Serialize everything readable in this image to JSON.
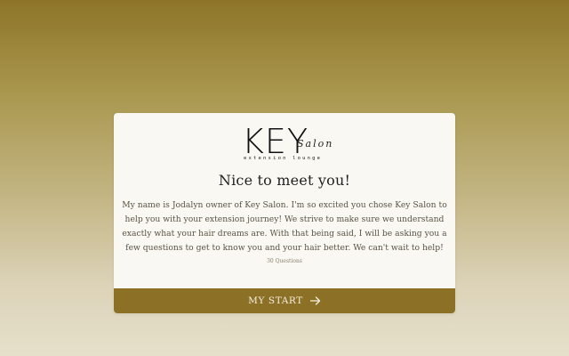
{
  "logo": {
    "main": "KEY",
    "script": "Salon",
    "tagline": "extension lounge"
  },
  "intro": {
    "title": "Nice to meet you!",
    "body": "My name is Jodalyn owner of Key Salon.  I'm so excited you chose Key Salon to help you with your extension journey! We strive to make sure we understand exactly what your hair dreams are.  With that being said, I will be asking you a few questions to get to know you and your hair better.  We can't wait to help!",
    "question_count": "30 Questions"
  },
  "start_button": {
    "label": "MY START",
    "icon": "arrow-right-icon"
  },
  "colors": {
    "accent": "#8c7026",
    "card": "#faf8f2",
    "background_top": "#8d7428",
    "background_bottom": "#e6e0cb"
  }
}
